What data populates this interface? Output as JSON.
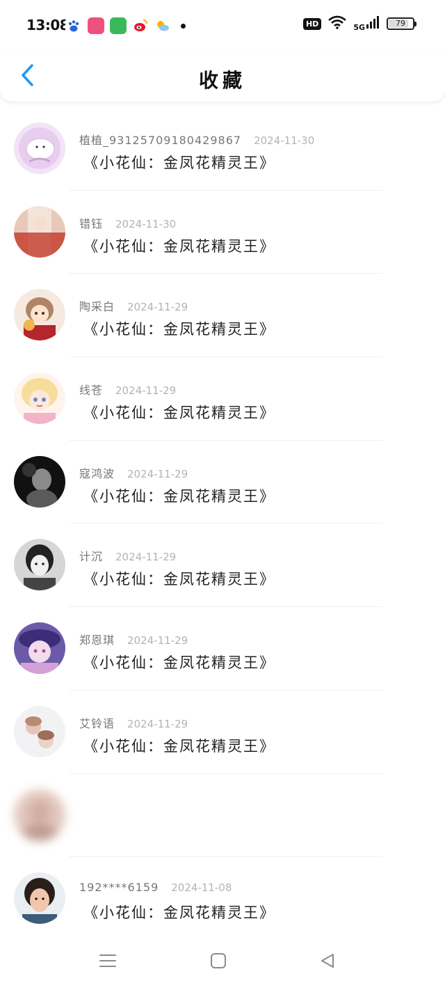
{
  "status_bar": {
    "time": "13:08",
    "network": "5G",
    "hd": "HD",
    "battery": "79"
  },
  "header": {
    "title": "收藏"
  },
  "favorites": [
    {
      "user": "植植_93125709180429867",
      "date": "2024-11-30",
      "title": "《小花仙：金凤花精灵王》"
    },
    {
      "user": "错钰",
      "date": "2024-11-30",
      "title": "《小花仙：金凤花精灵王》"
    },
    {
      "user": "陶采白",
      "date": "2024-11-29",
      "title": "《小花仙：金凤花精灵王》"
    },
    {
      "user": "线苍",
      "date": "2024-11-29",
      "title": "《小花仙：金凤花精灵王》"
    },
    {
      "user": "寇鸿波",
      "date": "2024-11-29",
      "title": "《小花仙：金凤花精灵王》"
    },
    {
      "user": "计沉",
      "date": "2024-11-29",
      "title": "《小花仙：金凤花精灵王》"
    },
    {
      "user": "郑恩琪",
      "date": "2024-11-29",
      "title": "《小花仙：金凤花精灵王》"
    },
    {
      "user": "艾铃语",
      "date": "2024-11-29",
      "title": "《小花仙：金凤花精灵王》"
    },
    {
      "user": "",
      "date": "",
      "title": ""
    },
    {
      "user": "192****6159",
      "date": "2024-11-08",
      "title": "《小花仙：金凤花精灵王》"
    }
  ],
  "colors": {
    "accent": "#2196F3",
    "username": "#777777",
    "date": "#b3b3b3"
  }
}
